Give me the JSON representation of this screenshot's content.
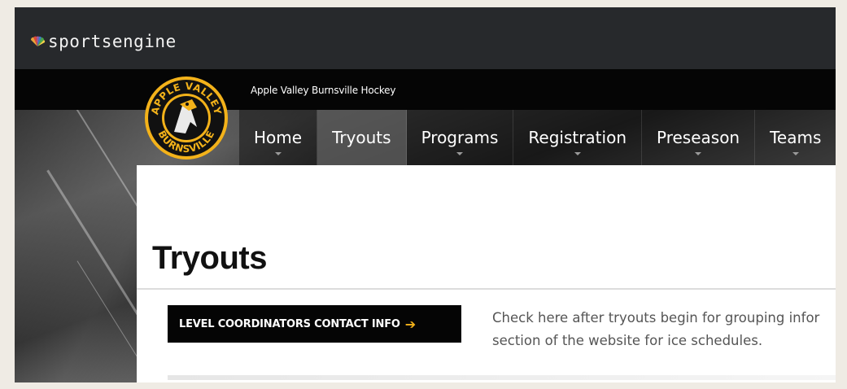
{
  "topbar": {
    "brand": "sportsengine",
    "brand_icon": "nbc-peacock-icon"
  },
  "org": {
    "name": "Apple Valley Burnsville Hockey",
    "crest_top": "APPLE VALLEY",
    "crest_bottom": "BURNSVILLE"
  },
  "nav": {
    "items": [
      {
        "label": "Home",
        "has_dropdown": true
      },
      {
        "label": "Tryouts",
        "has_dropdown": false,
        "active": true
      },
      {
        "label": "Programs",
        "has_dropdown": true
      },
      {
        "label": "Registration",
        "has_dropdown": true
      },
      {
        "label": "Preseason",
        "has_dropdown": true
      },
      {
        "label": "Teams",
        "has_dropdown": true
      }
    ]
  },
  "page": {
    "title": "Tryouts",
    "coordinators_button": "LEVEL COORDINATORS CONTACT INFO",
    "coordinators_arrow": "➔",
    "info_line1": "Check here after tryouts begin for grouping infor",
    "info_line2": "section of the website for ice schedules."
  },
  "colors": {
    "accent": "#f3b21a",
    "topbar": "#27292c",
    "orgbar": "#050505"
  }
}
